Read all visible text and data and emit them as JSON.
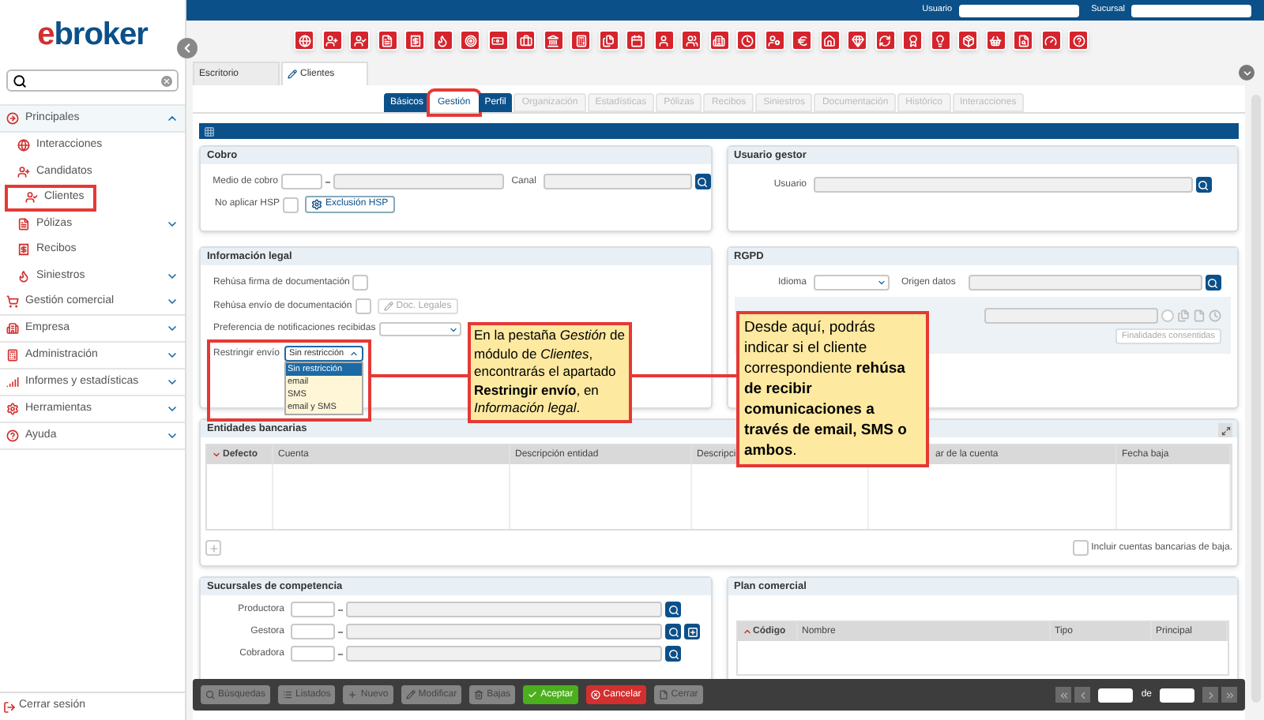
{
  "top_bar": {
    "user_label": "Usuario",
    "branch_label": "Sucursal"
  },
  "sidebar": {
    "logo": "ebroker",
    "items": [
      {
        "label": "Principales",
        "expanded": true,
        "children": [
          {
            "label": "Interacciones",
            "highlighted": false
          },
          {
            "label": "Candidatos",
            "highlighted": false
          },
          {
            "label": "Clientes",
            "highlighted": true
          },
          {
            "label": "Pólizas",
            "highlighted": false,
            "expanded": false
          },
          {
            "label": "Recibos",
            "highlighted": false
          },
          {
            "label": "Siniestros",
            "highlighted": false,
            "expanded": false
          }
        ]
      },
      {
        "label": "Gestión comercial",
        "expanded": false
      },
      {
        "label": "Empresa",
        "expanded": false
      },
      {
        "label": "Administración",
        "expanded": false
      },
      {
        "label": "Informes y estadísticas",
        "expanded": false
      },
      {
        "label": "Herramientas",
        "expanded": false
      },
      {
        "label": "Ayuda",
        "expanded": false
      }
    ],
    "logout": "Cerrar sesión"
  },
  "work_tabs": [
    {
      "label": "Escritorio",
      "selected": false
    },
    {
      "label": "Clientes",
      "selected": true
    }
  ],
  "sub_tabs": [
    {
      "label": "Básicos",
      "selected": false,
      "disabled": false,
      "highlighted": false
    },
    {
      "label": "Gestión",
      "selected": true,
      "disabled": false,
      "highlighted": true
    },
    {
      "label": "Perfil",
      "selected": false,
      "disabled": false,
      "highlighted": false
    },
    {
      "label": "Organización",
      "selected": false,
      "disabled": true,
      "highlighted": false
    },
    {
      "label": "Estadísticas",
      "selected": false,
      "disabled": true,
      "highlighted": false
    },
    {
      "label": "Pólizas",
      "selected": false,
      "disabled": true,
      "highlighted": false
    },
    {
      "label": "Recibos",
      "selected": false,
      "disabled": true,
      "highlighted": false
    },
    {
      "label": "Siniestros",
      "selected": false,
      "disabled": true,
      "highlighted": false
    },
    {
      "label": "Documentación",
      "selected": false,
      "disabled": true,
      "highlighted": false
    },
    {
      "label": "Histórico",
      "selected": false,
      "disabled": true,
      "highlighted": false
    },
    {
      "label": "Interacciones",
      "selected": false,
      "disabled": true,
      "highlighted": false
    }
  ],
  "cobro": {
    "title": "Cobro",
    "payment_method_label": "Medio de cobro",
    "channel_label": "Canal",
    "no_hsp": {
      "label": "No aplicar HSP",
      "checked": false
    },
    "hsp_button": "Exclusión HSP"
  },
  "user_manager": {
    "title": "Usuario gestor",
    "user_label": "Usuario"
  },
  "legal": {
    "title": "Información legal",
    "refuse_signature": {
      "label": "Rehúsa firma de documentación",
      "checked": false
    },
    "refuse_sending": {
      "label": "Rehúsa envío de documentación",
      "checked": false
    },
    "legal_docs_button": {
      "label": "Doc. Legales",
      "disabled": true
    },
    "notifications_label": "Preferencia de notificaciones recibidas",
    "restrict": {
      "label": "Restringir envío",
      "value": "Sin restricción",
      "expanded": true,
      "highlighted": true,
      "options": [
        {
          "label": "Sin restricción",
          "selected": true
        },
        {
          "label": "email",
          "selected": false
        },
        {
          "label": "SMS",
          "selected": false
        },
        {
          "label": "email y SMS",
          "selected": false
        }
      ]
    }
  },
  "rgpd": {
    "title": "RGPD",
    "language_label": "Idioma",
    "origin_label": "Origen datos",
    "purposes_button": {
      "label": "Finalidades consentidas",
      "disabled": true
    }
  },
  "bank": {
    "title": "Entidades bancarias",
    "columns": [
      {
        "label": "Defecto",
        "sorted": true,
        "descending": true
      },
      {
        "label": "Cuenta",
        "sorted": false
      },
      {
        "label": "Descripción entidad",
        "sorted": false
      },
      {
        "label": "Descripci",
        "sorted": false
      },
      {
        "label": "ar de la cuenta",
        "sorted": false
      },
      {
        "label": "Fecha baja",
        "sorted": false
      }
    ],
    "include_removed": {
      "label": "Incluir cuentas bancarias de baja.",
      "checked": false
    }
  },
  "branches": {
    "title": "Sucursales de competencia",
    "fields": [
      {
        "label": "Productora",
        "kind": "plain"
      },
      {
        "label": "Gestora",
        "kind": "with_add"
      },
      {
        "label": "Cobradora",
        "kind": "plain"
      }
    ]
  },
  "plan": {
    "title": "Plan comercial",
    "columns": [
      {
        "label": "Código",
        "sorted": true,
        "descending": false
      },
      {
        "label": "Nombre",
        "sorted": false
      },
      {
        "label": "Tipo",
        "sorted": false
      },
      {
        "label": "Principal",
        "sorted": false
      }
    ]
  },
  "actions": [
    {
      "label": "Búsquedas",
      "kind": "plain",
      "disabled": true
    },
    {
      "label": "Listados",
      "kind": "plain",
      "disabled": true
    },
    {
      "label": "Nuevo",
      "kind": "plain",
      "disabled": true
    },
    {
      "label": "Modificar",
      "kind": "plain",
      "disabled": true
    },
    {
      "label": "Bajas",
      "kind": "plain",
      "disabled": true
    },
    {
      "label": "Aceptar",
      "kind": "accept",
      "disabled": false
    },
    {
      "label": "Cancelar",
      "kind": "cancel",
      "disabled": false
    },
    {
      "label": "Cerrar",
      "kind": "plain",
      "disabled": true
    }
  ],
  "pager": {
    "of_label": "de"
  },
  "callouts": [
    {
      "text": "En la pestaña *Gestión* de módulo de *Clientes*, encontrarás el apartado **Restringir envío**, en *Información legal*."
    },
    {
      "text": "Desde aquí, podrás indicar si el cliente correspondiente **rehúsa de recibir comunicaciones a través de email, SMS o ambos**."
    }
  ]
}
